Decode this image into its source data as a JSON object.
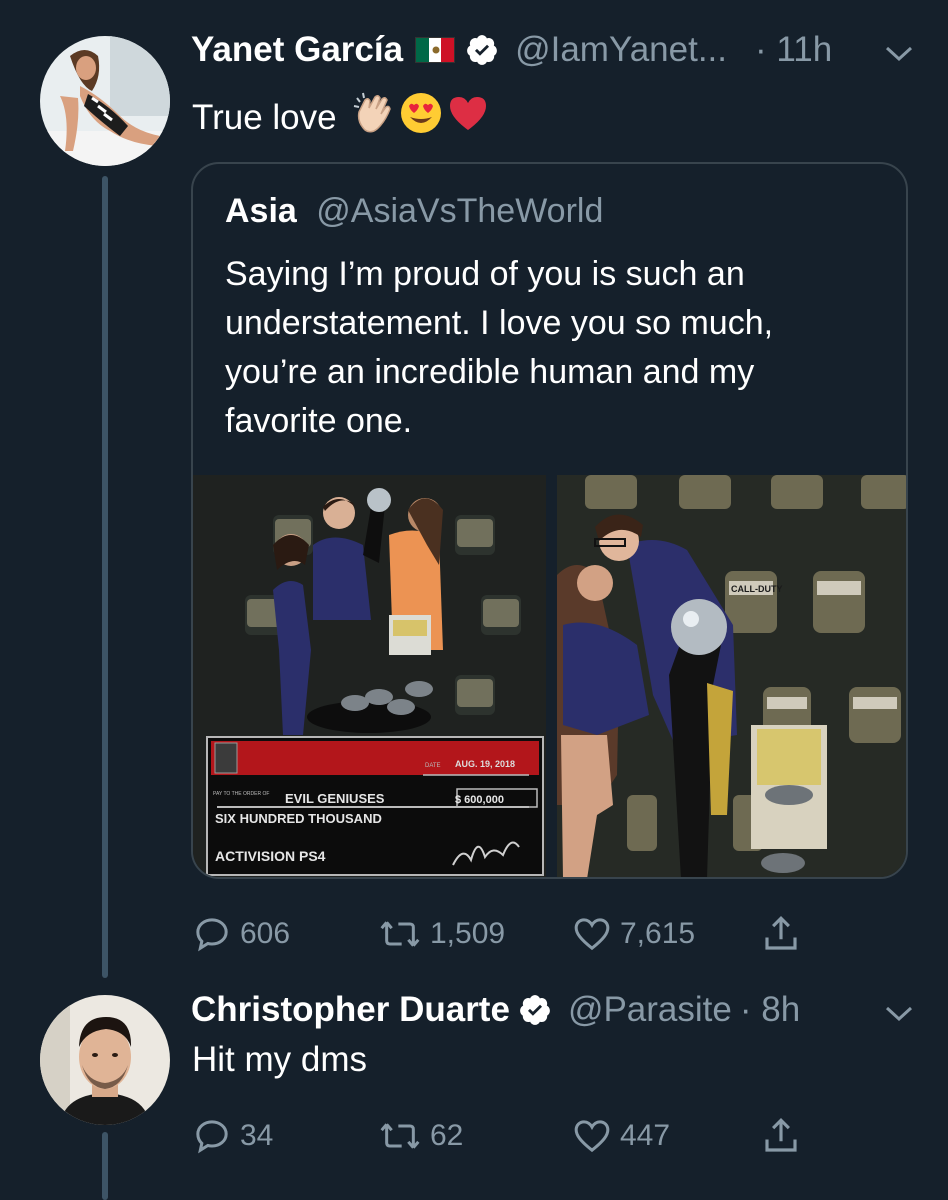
{
  "tweets": [
    {
      "name": "Yanet García",
      "handle": "@IamYanet...",
      "time": "· 11h",
      "text": "True love",
      "emojis": [
        "clap-icon",
        "heart-eyes-icon",
        "red-heart-icon"
      ],
      "flag": "mexico-flag",
      "replies": "606",
      "retweets": "1,509",
      "likes": "7,615"
    },
    {
      "name": "Christopher Duarte",
      "handle": "@Parasite",
      "time": "· 8h",
      "text": "Hit my dms",
      "replies": "34",
      "retweets": "62",
      "likes": "447"
    }
  ],
  "quote": {
    "name": "Asia",
    "handle": "@AsiaVsTheWorld",
    "lines": [
      "Saying I’m proud of you is such an",
      "understatement. I love you so much,",
      "you’re an incredible human and my",
      "favorite one."
    ]
  },
  "check": {
    "payee": "EVIL GENIUSES",
    "amount": "$ 600,000",
    "amount_words": "SIX HUNDRED THOUSAND",
    "date": "AUG. 19, 2018",
    "pay_to_label": "PAY TO THE ORDER OF",
    "date_label": "DATE",
    "sponsors": "ACTIVISION  PS4"
  },
  "backdrop_logo": "CALL-DUTY",
  "colors": {
    "background": "#15202b",
    "secondary_text": "#8899a6",
    "border": "#38444d",
    "thread_line": "#3d5466"
  }
}
